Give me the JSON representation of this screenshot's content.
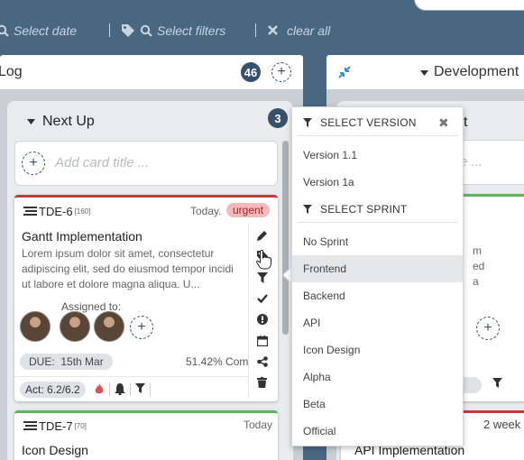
{
  "filter_bar": {
    "date_placeholder": "Select date",
    "filters_placeholder": "Select filters",
    "clear_all": "clear all"
  },
  "lanes": [
    {
      "title": "Log",
      "count": "46"
    },
    {
      "title": "Development",
      "partial_title_suffix": "t"
    }
  ],
  "column": {
    "title": "Next Up",
    "count": "3",
    "add_card_placeholder": "Add card title ..."
  },
  "cards": [
    {
      "id": "TDE-6",
      "points": "[160]",
      "date": "Today.",
      "badge": "urgent",
      "title": "Gantt Implementation",
      "description": [
        "Lorem ipsum dolor sit amet, consectetur",
        "adipiscing elit, sed do eiusmod tempor incidi",
        "ut labore et dolore magna aliqua. U..."
      ],
      "assigned_label": "Assigned to:",
      "due_label": "DUE:",
      "due_date": "15th Mar",
      "percent": "51.42% Com",
      "act": "Act: 6.2/6.2"
    },
    {
      "id": "TDE-7",
      "points": "[70]",
      "date": "Today",
      "title": "Icon Design"
    }
  ],
  "right_lane_fragments": {
    "desc_1": "m",
    "desc_2": "ed",
    "desc_3": "a",
    "search_frag": "e ...",
    "weeks": "2 week",
    "card_title": "API Implementation"
  },
  "dropdown": {
    "version_header": "SELECT VERSION",
    "versions": [
      "Version 1.1",
      "Version 1a"
    ],
    "sprint_header": "SELECT SPRINT",
    "sprints": [
      "No Sprint",
      "Frontend",
      "Backend",
      "API",
      "Icon Design",
      "Alpha",
      "Beta",
      "Official"
    ],
    "active_sprint": "Frontend"
  },
  "colors": {
    "background": "#4a6782",
    "badge": "#37506b",
    "urgent_bg": "#f5b8bb",
    "red_bar": "#c53a3a",
    "green_bar": "#5cb85c"
  }
}
